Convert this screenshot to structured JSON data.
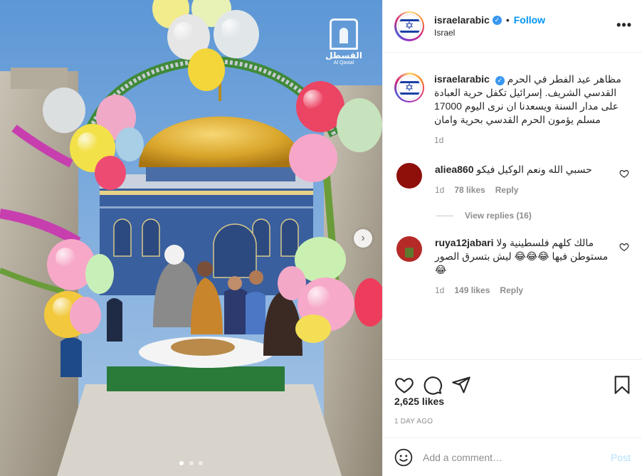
{
  "media": {
    "watermark_text": "القسطل",
    "watermark_sub": "Al Qastal",
    "carousel": {
      "total": 3,
      "active": 0
    }
  },
  "header": {
    "username": "israelarabic",
    "separator": "•",
    "follow_label": "Follow",
    "location": "Israel",
    "more_label": "•••"
  },
  "caption": {
    "username": "israelarabic",
    "text": "مظاهر عيد الفطر في الحرم القدسي الشريف. إسرائيل تكفل حرية العبادة على مدار السنة ويسعدنا ان نرى اليوم 17000 مسلم يؤمون الحرم القدسي بحرية وامان",
    "time": "1d"
  },
  "comments": [
    {
      "username": "aliea860",
      "text": "حسبي الله ونعم الوكيل فيكو",
      "time": "1d",
      "likes": "78 likes",
      "reply": "Reply",
      "view_replies": "View replies (16)"
    },
    {
      "username": "ruya12jabari",
      "text": "مالك كلهم فلسطينية ولا مستوطن فيها 😂😂😂 ليش بتسرق الصور😂",
      "time": "1d",
      "likes": "149 likes",
      "reply": "Reply"
    }
  ],
  "stats": {
    "likes": "2,625 likes",
    "date": "1 DAY AGO"
  },
  "add_comment": {
    "placeholder": "Add a comment…",
    "post_label": "Post"
  },
  "colors": {
    "accent": "#0095f6",
    "post_disabled": "#b2dffc",
    "muted": "#8e8e8e"
  },
  "icons": [
    "heart-icon",
    "comment-icon",
    "share-icon",
    "bookmark-icon",
    "emoji-icon",
    "verified-icon",
    "chevron-right-icon"
  ]
}
